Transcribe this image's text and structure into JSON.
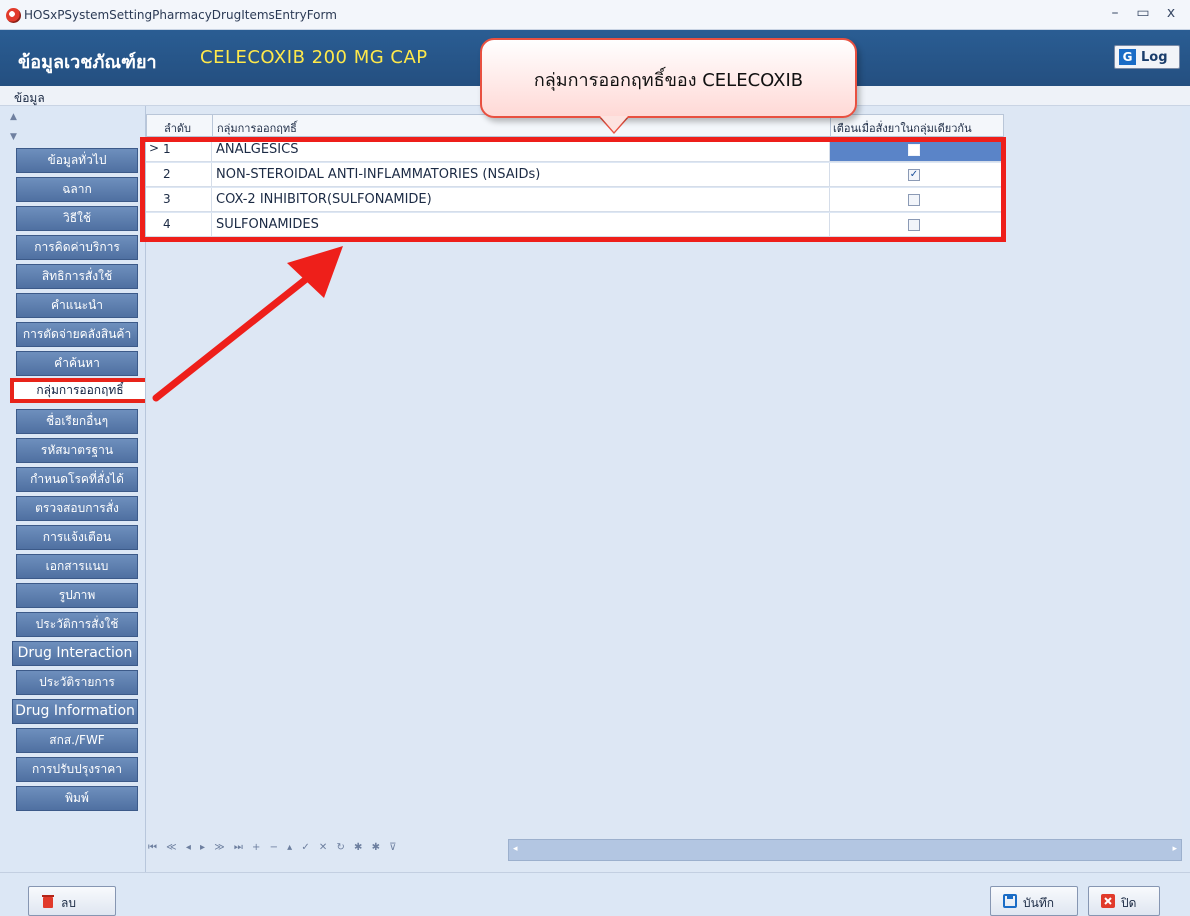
{
  "window": {
    "title": "HOSxPSystemSettingPharmacyDrugItemsEntryForm",
    "minimize": "–",
    "maximize": "▭",
    "close": "x"
  },
  "header": {
    "section_label": "ข้อมูลเวชภัณฑ์ยา",
    "drug_name": "CELECOXIB 200 MG CAP",
    "log_button": "Log",
    "log_icon_glyph": "G"
  },
  "menu": {
    "items": [
      "ข้อมูล"
    ]
  },
  "callout": {
    "text": "กลุ่มการออกฤทธิ์ของ CELECOXIB"
  },
  "sidebar": {
    "scroll_up": "▲",
    "scroll_down": "▼",
    "items": [
      {
        "label": "ข้อมูลทั่วไป"
      },
      {
        "label": "ฉลาก"
      },
      {
        "label": "วิธีใช้"
      },
      {
        "label": "การคิดค่าบริการ"
      },
      {
        "label": "สิทธิการสั่งใช้"
      },
      {
        "label": "คำแนะนำ"
      },
      {
        "label": "การตัดจ่ายคลังสินค้า"
      },
      {
        "label": "คำค้นหา"
      },
      {
        "label": "กลุ่มการออกฤทธิ์"
      },
      {
        "label": "ชื่อเรียกอื่นๆ"
      },
      {
        "label": "รหัสมาตรฐาน"
      },
      {
        "label": "กำหนดโรคที่สั่งได้"
      },
      {
        "label": "ตรวจสอบการสั่ง"
      },
      {
        "label": "การแจ้งเตือน"
      },
      {
        "label": "เอกสารแนบ"
      },
      {
        "label": "รูปภาพ"
      },
      {
        "label": "ประวัติการสั่งใช้"
      },
      {
        "label": "Drug Interaction"
      },
      {
        "label": "ประวัติรายการ"
      },
      {
        "label": "Drug Information"
      },
      {
        "label": "สกส./FWF"
      },
      {
        "label": "การปรับปรุงราคา"
      },
      {
        "label": "พิมพ์"
      }
    ],
    "active_index": 8
  },
  "grid": {
    "columns": [
      "ลำดับ",
      "กลุ่มการออกฤทธิ์",
      "เตือนเมื่อสั่งยาในกลุ่มเดียวกัน"
    ],
    "rows": [
      {
        "seq": "1",
        "group": "ANALGESICS",
        "warn": false,
        "current": true
      },
      {
        "seq": "2",
        "group": "NON-STEROIDAL ANTI-INFLAMMATORIES (NSAIDs)",
        "warn": true,
        "current": false
      },
      {
        "seq": "3",
        "group": "COX-2 INHIBITOR(SULFONAMIDE)",
        "warn": false,
        "current": false
      },
      {
        "seq": "4",
        "group": "SULFONAMIDES",
        "warn": false,
        "current": false
      }
    ],
    "row_indicator": ">",
    "navigator": "⏮ ≪ ◂ ▸ ≫ ⏭ + − ▴ ✓ ✕ ↻ ✱ ✱ ⊽"
  },
  "footer": {
    "delete_button": "ลบ",
    "save_button": "บันทึก",
    "close_button": "ปิด"
  },
  "colors": {
    "header_bg": "#2a5d93",
    "drug_name": "#ffe94a",
    "highlight": "#ee1f1a",
    "sidebar_button": "#5f80b0",
    "selected_cell": "#5a84c8"
  }
}
